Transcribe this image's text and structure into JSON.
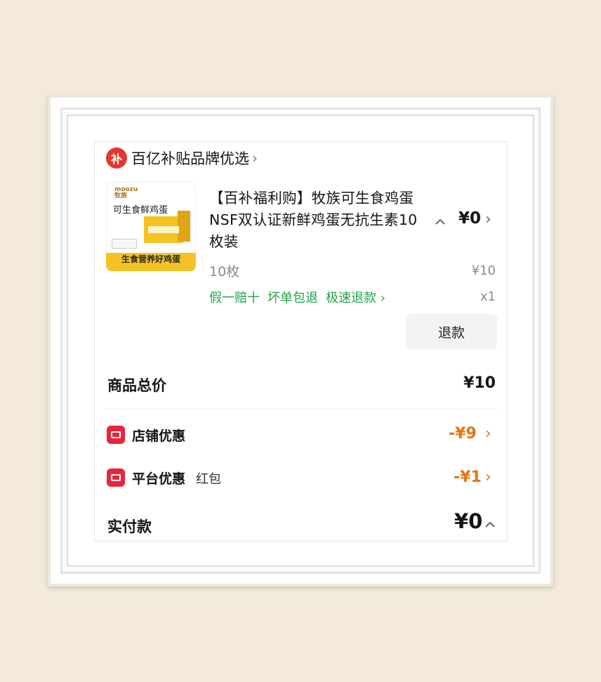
{
  "store": {
    "badge": "补",
    "name": "百亿补贴品牌优选",
    "chevron": "›"
  },
  "product": {
    "image": {
      "logo": "moozu\n牧族",
      "heading": "可生食鲜鸡蛋",
      "banner": "生食营养好鸡蛋"
    },
    "title": "【百补福利购】牧族可生食鸡蛋NSF双认证新鲜鸡蛋无抗生素10枚装",
    "spec": "10枚",
    "price": "¥0",
    "original_price": "¥10",
    "quantity": "x1",
    "services": [
      "假一赔十",
      "坏单包退",
      "极速退款 ›"
    ],
    "refund_button": "退款"
  },
  "summary": {
    "total_label": "商品总价",
    "total_value": "¥10",
    "store_discount_label": "店铺优惠",
    "store_discount_value": "-¥9",
    "platform_discount_label": "平台优惠",
    "platform_discount_sub": "红包",
    "platform_discount_value": "-¥1",
    "paid_label": "实付款",
    "paid_value": "¥0"
  },
  "colors": {
    "accent_red": "#e5362e",
    "discount_orange": "#e67410",
    "service_green": "#22a447"
  }
}
